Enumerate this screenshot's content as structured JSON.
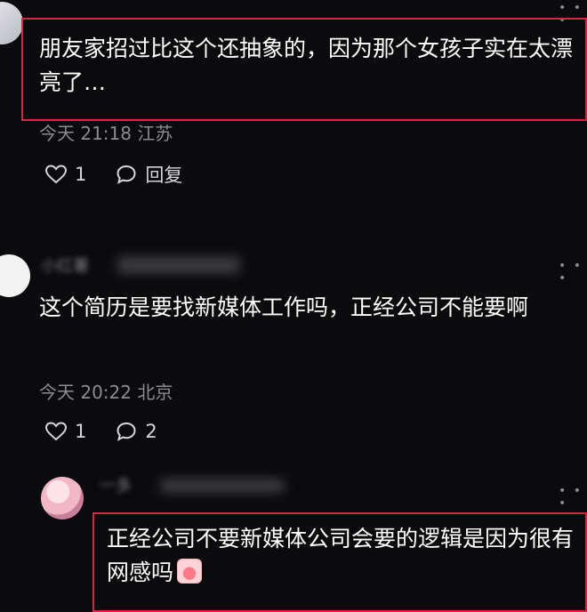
{
  "comments": [
    {
      "content": "朋友家招过比这个还抽象的，因为那个女孩子实在太漂亮了…",
      "time": "今天 21:18",
      "location": "江苏",
      "likes": "1",
      "reply_label": "回复"
    },
    {
      "username": "小红薯",
      "content": "这个简历是要找新媒体工作吗，正经公司不能要啊",
      "time": "今天 20:22",
      "location": "北京",
      "likes": "1",
      "replies": "2"
    },
    {
      "username": "一多",
      "content": "正经公司不要新媒体公司会要的逻辑是因为很有网感吗",
      "emoji": "face-emoji"
    }
  ],
  "icons": [
    "heart-icon",
    "comment-bubble-icon",
    "more-dots-icon"
  ],
  "colors": {
    "background": "#0b0b0d",
    "highlight_box": "#d7263d",
    "meta_text": "#8b8b91"
  }
}
